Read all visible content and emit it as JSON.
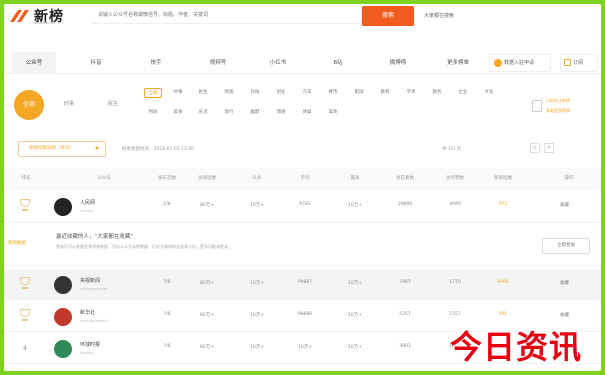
{
  "header": {
    "logo_text": "新榜",
    "logo_sub": "NEWRANK.CN",
    "search_placeholder": "请输入公众号名称或微信号、标题、作者、关键词",
    "search_button": "搜索",
    "right_link": "大家都在搜索"
  },
  "tabs": [
    {
      "label": "公众号",
      "active": true
    },
    {
      "label": "抖音",
      "active": false
    },
    {
      "label": "快手",
      "active": false
    },
    {
      "label": "视频号",
      "active": false
    },
    {
      "label": "小红书",
      "active": false
    },
    {
      "label": "B站",
      "active": false
    },
    {
      "label": "微博榜",
      "active": false
    },
    {
      "label": "更多榜单",
      "active": false
    }
  ],
  "tab_cta": "数据入驻申请",
  "tab_cta2": "订阅",
  "filter": {
    "all_label": "全部",
    "opt1": "时事",
    "opt2": "民生",
    "chips_row1": [
      "全部",
      "时事",
      "民生",
      "财富",
      "科技",
      "创业",
      "汽车",
      "楼市",
      "职场",
      "教育",
      "学术",
      "政务",
      "企业",
      "文化",
      "百科",
      "健康"
    ],
    "chips_row2": [
      "时尚",
      "美食",
      "乐活",
      "旅行",
      "幽默",
      "情感",
      "体娱",
      "美体"
    ],
    "qr_line1": "扫码关注新榜",
    "qr_line2": "获取更多榜单"
  },
  "toolbar": {
    "select_label": "新榜指数日榜（昨日）",
    "update_text": "榜单更新时间：2024-01-05 12:00",
    "page_info": "共 1/5 页",
    "prev": "<",
    "next": ">"
  },
  "table": {
    "headers": [
      "排名",
      "公众号",
      "发布次数",
      "总阅读数",
      "头条",
      "平均",
      "最高",
      "总在看数",
      "总点赞数",
      "新榜指数",
      "操作"
    ],
    "rows": [
      {
        "rank": "",
        "name": "人民网",
        "sub": "rmrbwx",
        "cells": [
          "1/8",
          "80万+",
          "10万+",
          "9783",
          "10万+",
          "29689",
          "4949",
          "975"
        ],
        "collect": "收藏",
        "avatar_color": "#222222",
        "medal": true,
        "grey": false
      },
      {
        "rank": "",
        "name": "央视新闻",
        "sub": "cctvnewscenter",
        "cells": [
          "7/8",
          "80万+",
          "10万+",
          "99887",
          "10万+",
          "7967",
          "1770",
          "9905"
        ],
        "collect": "收藏",
        "avatar_color": "#333333",
        "medal": true,
        "grey": true
      },
      {
        "rank": "",
        "name": "新华社",
        "sub": "xinhuashefabu1",
        "cells": [
          "7/8",
          "80万+",
          "10万+",
          "98886",
          "10万+",
          "5357",
          "1557",
          "991"
        ],
        "collect": "收藏",
        "avatar_color": "#c0392b",
        "medal": true,
        "grey": false
      },
      {
        "rank": "4",
        "name": "环球时报",
        "sub": "hqsbwx",
        "cells": [
          "7/8",
          "80万+",
          "10万+",
          "10万+",
          "10万+",
          "3801",
          "1080",
          "887"
        ],
        "collect": "收藏",
        "avatar_color": "#2e8b57",
        "medal": false,
        "grey": false
      }
    ]
  },
  "notice": {
    "tag": "新榜数据",
    "title": "最近收藏的人，“大家都在收藏”",
    "sub": "登录后可以查看更多榜单数据，包括公众号详细数据、历史文章和粉丝画像分析，更多功能请登录。",
    "button": "立即登录"
  },
  "watermark": "今日资讯",
  "colors": {
    "accent": "#f5a623",
    "brand": "#f25c21",
    "frame": "#7ed321"
  }
}
